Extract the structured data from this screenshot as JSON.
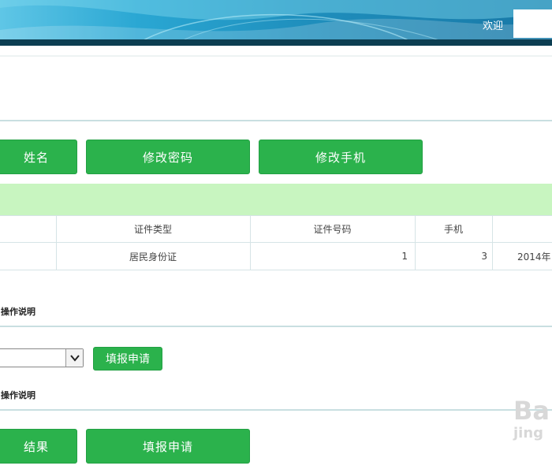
{
  "header": {
    "welcome_text": "欢迎"
  },
  "top_buttons": {
    "name_partial": "姓名",
    "change_password": "修改密码",
    "change_phone": "修改手机"
  },
  "table": {
    "headers": {
      "id_type": "证件类型",
      "id_number": "证件号码",
      "phone": "手机"
    },
    "row": {
      "id_type": "居民身份证",
      "id_number": "1",
      "phone": "3",
      "date_partial": "2014年"
    }
  },
  "section1": {
    "label": "操作说明",
    "select_value": "",
    "submit_label": "填报申请"
  },
  "section2": {
    "label": "操作说明",
    "result_partial": "结果",
    "apply_label": "填报申请"
  },
  "watermark": {
    "top": "Ba",
    "bottom": "jing"
  },
  "colors": {
    "button_green": "#2bb24c",
    "band_green": "#c8f5c0",
    "header_blue": "#1f8fbd",
    "header_dark": "#0c3e52"
  },
  "icons": {
    "select_arrow": "chevron-down-icon"
  }
}
